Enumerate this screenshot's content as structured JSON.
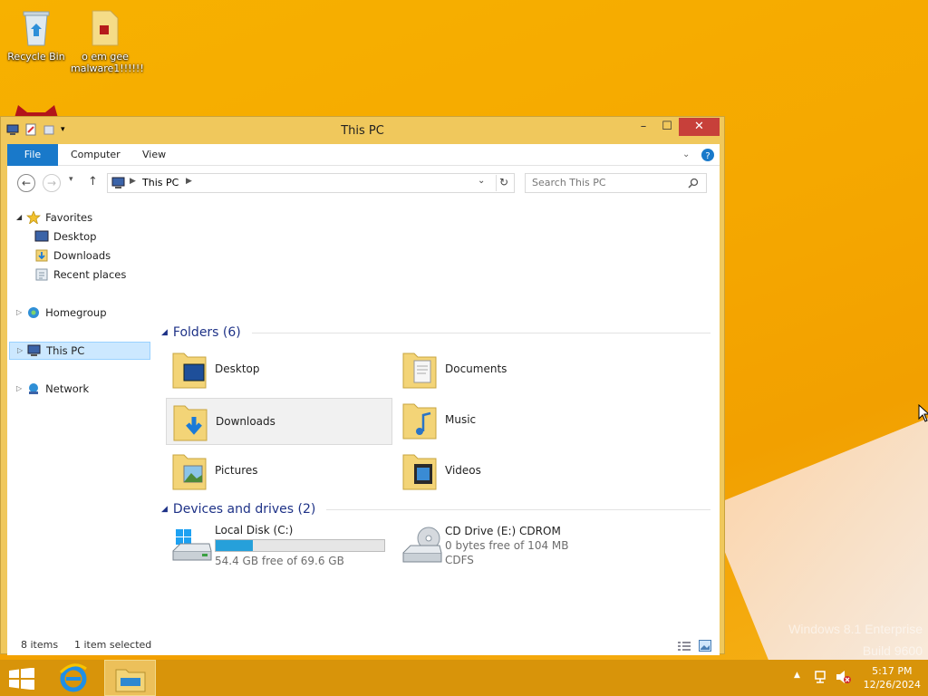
{
  "desktop": {
    "icons": [
      {
        "label": "Recycle Bin"
      },
      {
        "label": "o em gee malware1!!!!!!"
      }
    ],
    "watermark": {
      "line1": "Windows 8.1 Enterprise",
      "line2": "Build 9600"
    }
  },
  "window": {
    "title": "This PC",
    "controls": {
      "minimize": "–",
      "maximize": "☐",
      "close": "✕"
    },
    "ribbon": {
      "tabs": [
        {
          "label": "File"
        },
        {
          "label": "Computer"
        },
        {
          "label": "View"
        }
      ]
    },
    "address": {
      "crumb": "This PC",
      "search_placeholder": "Search This PC"
    },
    "nav": {
      "favorites": "Favorites",
      "desktop": "Desktop",
      "downloads": "Downloads",
      "recent": "Recent places",
      "homegroup": "Homegroup",
      "thispc": "This PC",
      "network": "Network"
    },
    "folders": {
      "heading": "Folders (6)",
      "items": [
        {
          "label": "Desktop"
        },
        {
          "label": "Documents"
        },
        {
          "label": "Downloads"
        },
        {
          "label": "Music"
        },
        {
          "label": "Pictures"
        },
        {
          "label": "Videos"
        }
      ]
    },
    "devices": {
      "heading": "Devices and drives (2)",
      "drives": [
        {
          "name": "Local Disk (C:)",
          "free": "54.4 GB free of 69.6 GB",
          "used_fraction": 0.22
        },
        {
          "name": "CD Drive (E:) CDROM",
          "free": "0 bytes free of 104 MB",
          "fs": "CDFS"
        }
      ]
    },
    "status": {
      "items": "8 items",
      "selected": "1 item selected"
    }
  },
  "taskbar": {
    "clock_time": "5:17 PM",
    "clock_date": "12/26/2024"
  },
  "colors": {
    "accent": "#1979ca",
    "close": "#c7403a",
    "group_heading": "#1e3287",
    "frame": "#f0c85c"
  }
}
